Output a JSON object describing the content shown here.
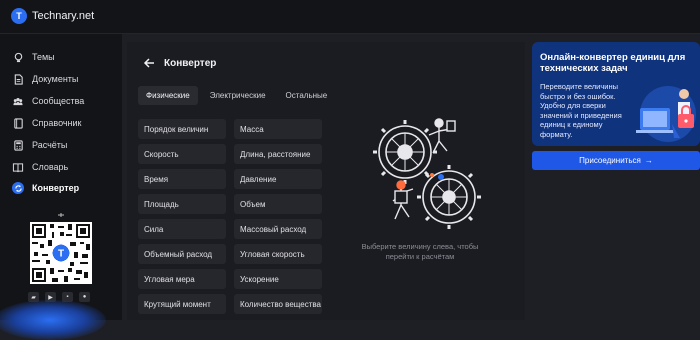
{
  "brand": {
    "name": "Technary.net"
  },
  "sidebar": {
    "items": [
      {
        "label": "Темы",
        "icon": "bulb-icon"
      },
      {
        "label": "Документы",
        "icon": "document-icon"
      },
      {
        "label": "Сообщества",
        "icon": "community-icon"
      },
      {
        "label": "Справочник",
        "icon": "book-icon"
      },
      {
        "label": "Расчёты",
        "icon": "calculator-icon"
      },
      {
        "label": "Словарь",
        "icon": "dictionary-icon"
      },
      {
        "label": "Конвертер",
        "icon": "converter-icon",
        "active": true
      }
    ],
    "stores": [
      "store-icon",
      "play-icon",
      "appgallery-icon",
      "apple-icon"
    ]
  },
  "page": {
    "title": "Конвертер"
  },
  "tabs": [
    {
      "label": "Физические",
      "active": true
    },
    {
      "label": "Электрические"
    },
    {
      "label": "Остальные"
    }
  ],
  "quantities": {
    "left": [
      "Порядок величин",
      "Скорость",
      "Время",
      "Площадь",
      "Сила",
      "Объемный расход",
      "Угловая мера",
      "Крутящий момент"
    ],
    "right": [
      "Масса",
      "Длина, расстояние",
      "Давление",
      "Объем",
      "Массовый расход",
      "Угловая скорость",
      "Ускорение",
      "Количество вещества"
    ]
  },
  "hint": "Выберите величину слева, чтобы перейти к расчётам",
  "promo": {
    "title": "Онлайн-конвертер единиц для технических задач",
    "text": "Переводите величины быстро и без ошибок. Удобно для сверки значений и приведения единиц к единому формату.",
    "button": "Присоединиться"
  },
  "colors": {
    "accent": "#2b6ef2",
    "promo_bg": "#10337e",
    "button": "#1f57e6",
    "background": "#1e1f24"
  }
}
